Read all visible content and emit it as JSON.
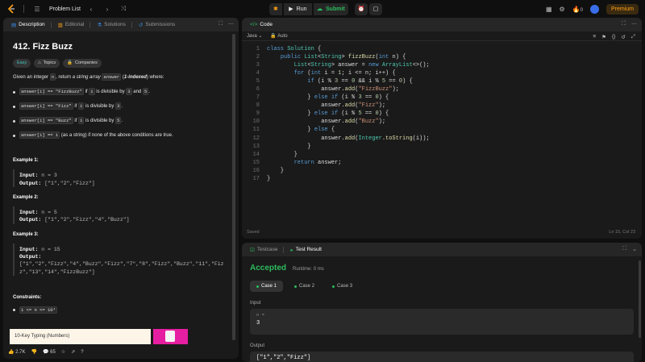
{
  "topbar": {
    "title": "Problem List",
    "run_label": "Run",
    "submit_label": "Submit",
    "streak_count": "0",
    "premium_label": "Premium"
  },
  "left_tabs": {
    "description": "Description",
    "editorial": "Editorial",
    "solutions": "Solutions",
    "submissions": "Submissions"
  },
  "problem": {
    "title": "412. Fizz Buzz",
    "difficulty": "Easy",
    "topics": "Topics",
    "companies": "Companies",
    "intro_a": "Given an integer ",
    "intro_n": "n",
    "intro_b": ", return ",
    "intro_c": "a string array ",
    "intro_answer": "answer",
    "intro_d": " (",
    "intro_e": "1-indexed",
    "intro_f": ") where:",
    "rules": [
      {
        "code": "answer[i] == \"FizzBuzz\"",
        "t1": " if ",
        "i": "i",
        "t2": " is divisible by ",
        "a": "3",
        "t3": " and ",
        "b": "5",
        "t4": "."
      },
      {
        "code": "answer[i] == \"Fizz\"",
        "t1": " if ",
        "i": "i",
        "t2": " is divisible by ",
        "a": "3",
        "t4": "."
      },
      {
        "code": "answer[i] == \"Buzz\"",
        "t1": " if ",
        "i": "i",
        "t2": " is divisible by ",
        "a": "5",
        "t4": "."
      },
      {
        "code": "answer[i] == i",
        "t1": " (as a string) if none of the above conditions are true."
      }
    ],
    "examples": [
      {
        "title": "Example 1:",
        "input_label": "Input:",
        "input": " n = 3",
        "output_label": "Output:",
        "output": " [\"1\",\"2\",\"Fizz\"]"
      },
      {
        "title": "Example 2:",
        "input_label": "Input:",
        "input": " n = 5",
        "output_label": "Output:",
        "output": " [\"1\",\"2\",\"Fizz\",\"4\",\"Buzz\"]"
      },
      {
        "title": "Example 3:",
        "input_label": "Input:",
        "input": " n = 15",
        "output_label": "Output:",
        "output_line1": "[\"1\",\"2\",\"Fizz\",\"4\",\"Buzz\",\"Fizz\",\"7\",\"8\",\"Fizz\",\"Buzz\",\"11\",\"Fiz",
        "output_line2": "z\",\"13\",\"14\",\"FizzBuzz\"]"
      }
    ],
    "constraints_title": "Constraints:",
    "constraint": "1 <= n <= 10⁴"
  },
  "ad": {
    "text": "10-Key Typing (Numbers)"
  },
  "footer": {
    "likes": "2.7K",
    "comments": "65"
  },
  "code_panel": {
    "tab": "Code",
    "language": "Java",
    "mode": "Auto",
    "saved": "Saved",
    "cursor": "Ln 15, Col 23"
  },
  "result_panel": {
    "testcase_tab": "Testcase",
    "result_tab": "Test Result",
    "status": "Accepted",
    "runtime": "Runtime: 0 ms",
    "cases": [
      "Case 1",
      "Case 2",
      "Case 3"
    ],
    "input_label": "Input",
    "input_key": "n =",
    "input_value": "3",
    "output_label": "Output",
    "output_value": "[\"1\",\"2\",\"Fizz\"]"
  },
  "colors": {
    "accent_green": "#2cbb5d",
    "premium_orange": "#ffa116",
    "easy_teal": "#46c6c2"
  }
}
